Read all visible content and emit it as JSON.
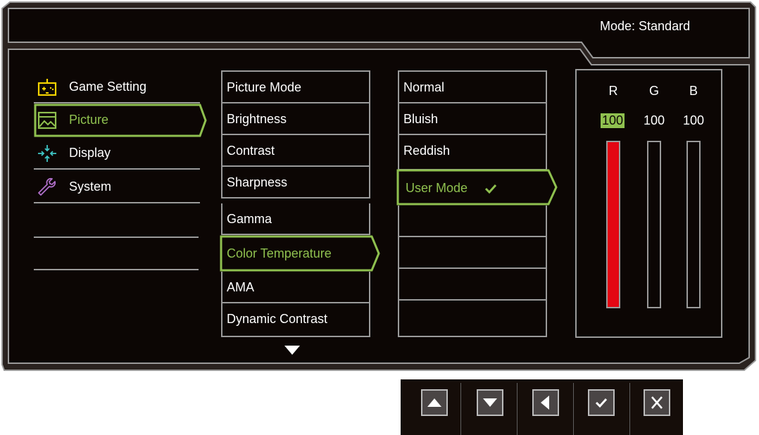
{
  "header": {
    "mode_label": "Mode: Standard"
  },
  "categories": [
    {
      "label": "Game Setting",
      "icon": "gamepad-icon",
      "selected": false
    },
    {
      "label": "Picture",
      "icon": "picture-icon",
      "selected": true
    },
    {
      "label": "Display",
      "icon": "display-arrows-icon",
      "selected": false
    },
    {
      "label": "System",
      "icon": "wrench-icon",
      "selected": false
    }
  ],
  "picture_menu": {
    "items": [
      "Picture Mode",
      "Brightness",
      "Contrast",
      "Sharpness",
      "Gamma",
      "Color Temperature",
      "AMA",
      "Dynamic Contrast"
    ],
    "selected": "Color Temperature",
    "more_indicator": "triangle-down-icon"
  },
  "color_temperature_menu": {
    "items": [
      "Normal",
      "Bluish",
      "Reddish",
      "User Mode",
      "",
      "",
      "",
      ""
    ],
    "selected": "User Mode",
    "selected_mark": "checkmark-icon"
  },
  "rgb": {
    "channels": [
      {
        "label": "R",
        "value": "100",
        "level": 100,
        "selected": true
      },
      {
        "label": "G",
        "value": "100",
        "level": 0,
        "selected": false
      },
      {
        "label": "B",
        "value": "100",
        "level": 0,
        "selected": false
      }
    ]
  },
  "controls": [
    "up-icon",
    "down-icon",
    "left-icon",
    "confirm-icon",
    "close-icon"
  ],
  "colors": {
    "accent": "#8fc04f",
    "background": "#0c0604",
    "border": "#9a9a9a",
    "red_bar": "#e30613",
    "icon_yellow": "#f5d400"
  }
}
